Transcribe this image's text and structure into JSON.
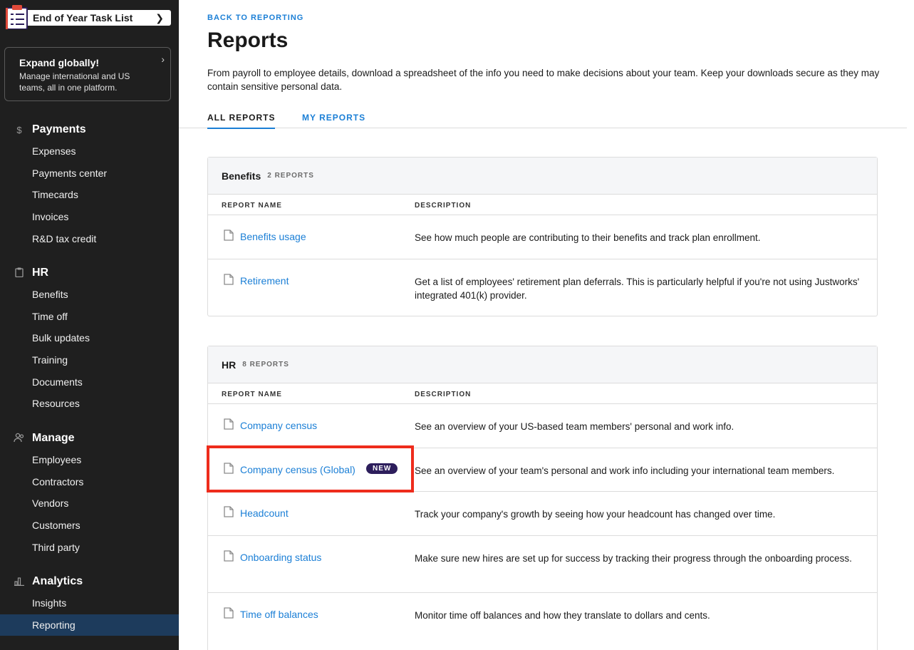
{
  "sidebar": {
    "task_list": {
      "label": "End of Year Task List"
    },
    "promo": {
      "title": "Expand globally!",
      "body": "Manage international and US teams, all in one platform."
    },
    "sections": [
      {
        "title": "Payments",
        "icon": "dollar-icon",
        "glyph": "$",
        "items": [
          "Expenses",
          "Payments center",
          "Timecards",
          "Invoices",
          "R&D tax credit"
        ]
      },
      {
        "title": "HR",
        "icon": "clipboard-icon",
        "glyph": "",
        "items": [
          "Benefits",
          "Time off",
          "Bulk updates",
          "Training",
          "Documents",
          "Resources"
        ]
      },
      {
        "title": "Manage",
        "icon": "people-icon",
        "glyph": "",
        "items": [
          "Employees",
          "Contractors",
          "Vendors",
          "Customers",
          "Third party"
        ]
      },
      {
        "title": "Analytics",
        "icon": "chart-icon",
        "glyph": "",
        "items": [
          "Insights",
          "Reporting"
        ]
      }
    ],
    "active_item": "Reporting"
  },
  "main": {
    "back_link": "BACK TO REPORTING",
    "title": "Reports",
    "intro": "From payroll to employee details, download a spreadsheet of the info you need to make decisions about your team. Keep your downloads secure as they may contain sensitive personal data.",
    "tabs": [
      {
        "label": "ALL REPORTS",
        "active": true
      },
      {
        "label": "MY REPORTS",
        "active": false
      }
    ],
    "columns": {
      "name": "REPORT NAME",
      "description": "DESCRIPTION"
    },
    "cards": [
      {
        "title": "Benefits",
        "count": "2 REPORTS",
        "rows": [
          {
            "name": "Benefits usage",
            "description": "See how much people are contributing to their benefits and track plan enrollment."
          },
          {
            "name": "Retirement",
            "description": "Get a list of employees' retirement plan deferrals. This is particularly helpful if you're not using Justworks' integrated 401(k) provider."
          }
        ]
      },
      {
        "title": "HR",
        "count": "8 REPORTS",
        "rows": [
          {
            "name": "Company census",
            "description": "See an overview of your US-based team members' personal and work info."
          },
          {
            "name": "Company census (Global)",
            "badge": "NEW",
            "description": "See an overview of your team's personal and work info including your international team members."
          },
          {
            "name": "Headcount",
            "description": "Track your company's growth by seeing how your headcount has changed over time."
          },
          {
            "name": "Onboarding status",
            "description": "Make sure new hires are set up for success by tracking their progress through the onboarding process."
          },
          {
            "name": "Time off balances",
            "description": "Monitor time off balances and how they translate to dollars and cents."
          }
        ]
      }
    ]
  },
  "colors": {
    "link": "#1b7fd6",
    "sidebar_bg": "#1f1f1f",
    "active_nav": "#1d3b5c",
    "badge": "#2d1e5c",
    "highlight": "#ee2c1c"
  }
}
